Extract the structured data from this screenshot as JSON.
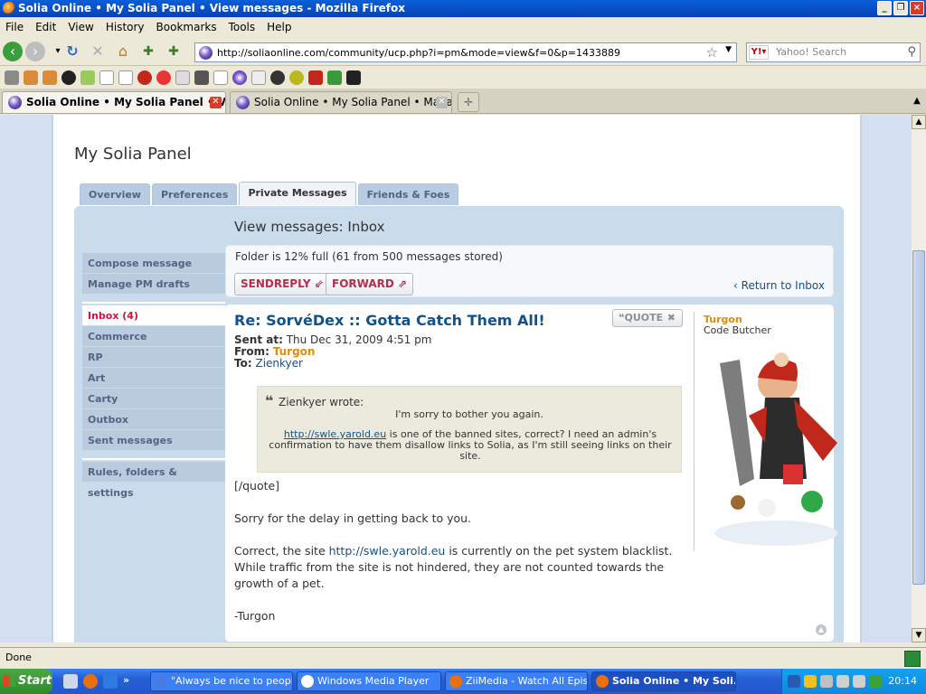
{
  "window": {
    "title": "Solia Online • My Solia Panel • View messages - Mozilla Firefox"
  },
  "menu": [
    "File",
    "Edit",
    "View",
    "History",
    "Bookmarks",
    "Tools",
    "Help"
  ],
  "nav": {
    "url": "http://soliaonline.com/community/ucp.php?i=pm&mode=view&f=0&p=1433889",
    "search_placeholder": "Yahoo! Search"
  },
  "tabs": [
    {
      "label": "Solia Online • My Solia Panel • Vi...",
      "active": true
    },
    {
      "label": "Solia Online • My Solia Panel • Manage ...",
      "active": false
    }
  ],
  "page": {
    "title": "My Solia Panel",
    "cp_tabs": [
      "Overview",
      "Preferences",
      "Private Messages",
      "Friends & Foes"
    ],
    "section_title": "View messages: Inbox",
    "left_nav": {
      "group1": [
        "Compose message",
        "Manage PM drafts"
      ],
      "group2": [
        "Inbox (4)",
        "Commerce",
        "RP",
        "Art",
        "Carty",
        "Outbox",
        "Sent messages"
      ],
      "group3": [
        "Rules, folders & settings"
      ]
    },
    "folder_status": "Folder is 12% full (61 from 500 messages stored)",
    "buttons": {
      "sendreply": "SENDREPLY ⇙",
      "forward": "FORWARD ⇗",
      "return": "Return to Inbox",
      "quote": "QUOTE"
    },
    "message": {
      "subject": "Re: SorvéDex :: Gotta Catch Them All!",
      "sent_label": "Sent at:",
      "sent_value": "Thu Dec 31, 2009 4:51 pm",
      "from_label": "From:",
      "from_value": "Turgon",
      "to_label": "To:",
      "to_value": "Zienkyer",
      "quote_author": "Zienkyer wrote:",
      "quote_line1": "I'm sorry to bother you again.",
      "quote_link": "http://swle.yarold.eu",
      "quote_line2": " is one of the banned sites, correct? I need an admin's confirmation to have them disallow links to Solia, as I'm still seeing links on their site.",
      "body_l1": "[/quote]",
      "body_l2": "Sorry for the delay in getting back to you.",
      "body_l3a": "Correct, the site ",
      "body_l3_link": "http://swle.yarold.eu",
      "body_l3b": " is currently on the pet system blacklist. While traffic from the site is not hindered, they are not counted towards the growth of a pet.",
      "body_l4": "-Turgon"
    },
    "profile": {
      "username": "Turgon",
      "rank": "Code Butcher"
    }
  },
  "status": "Done",
  "taskbar": {
    "start": "Start",
    "items": [
      {
        "label": "\"Always be nice to peopl...",
        "active": false
      },
      {
        "label": "Windows Media Player",
        "active": false
      },
      {
        "label": "ZiiMedia - Watch All Epis...",
        "active": false
      },
      {
        "label": "Solia Online • My Soli...",
        "active": true
      }
    ],
    "clock": "20:14"
  }
}
